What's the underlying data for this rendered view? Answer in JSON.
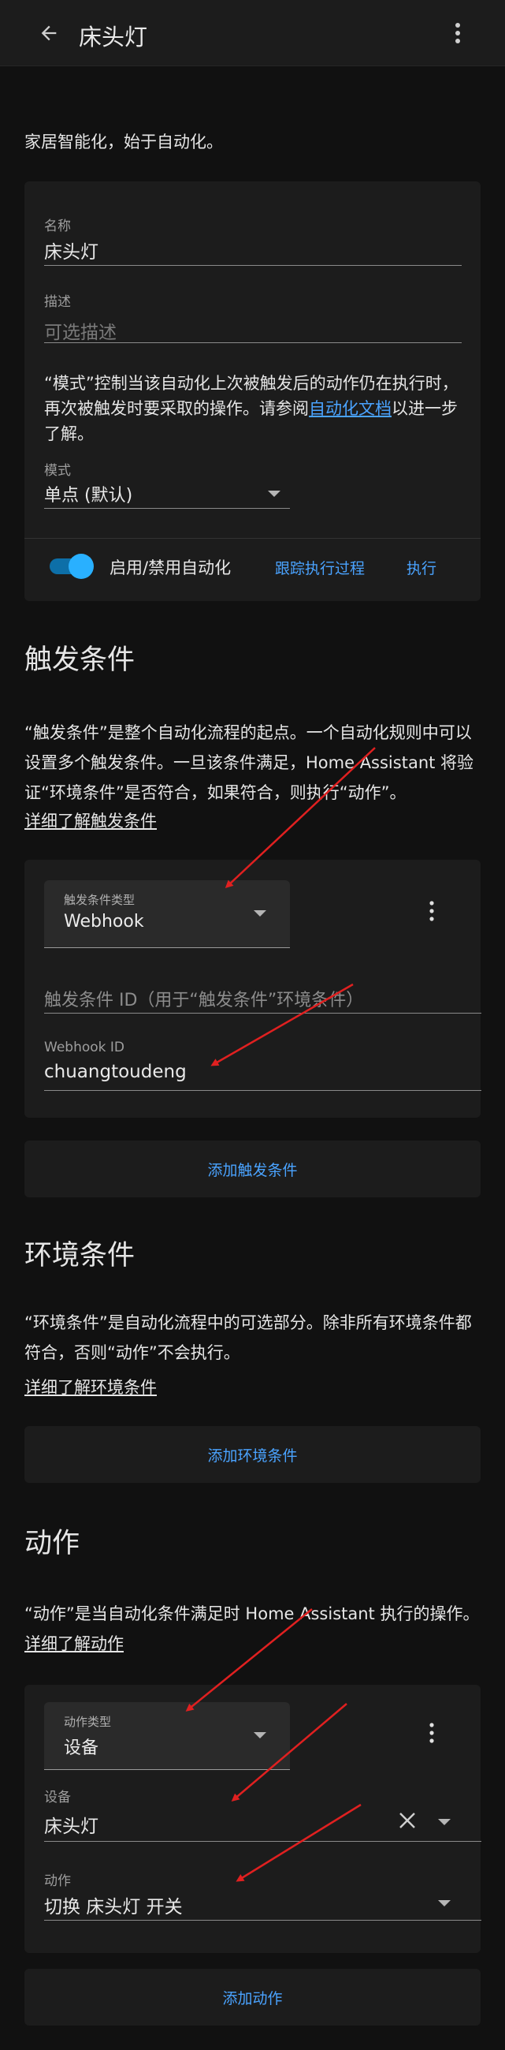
{
  "header": {
    "title": "床头灯"
  },
  "intro": "家居智能化，始于自动化。",
  "settings": {
    "name_label": "名称",
    "name_value": "床头灯",
    "desc_label": "描述",
    "desc_placeholder": "可选描述",
    "mode_text_before": "“模式”控制当该自动化上次被触发后的动作仍在执行时，再次被触发时要采取的操作。请参阅",
    "mode_link": "自动化文档",
    "mode_text_after": "以进一步了解。",
    "mode_label": "模式",
    "mode_value": "单点 (默认)",
    "toggle_label": "启用/禁用自动化",
    "trace_link": "跟踪执行过程",
    "run_link": "执行"
  },
  "triggers": {
    "heading": "触发条件",
    "description": "“触发条件”是整个自动化流程的起点。一个自动化规则中可以设置多个触发条件。一旦该条件满足，Home Assistant 将验证“环境条件”是否符合，如果符合，则执行“动作”。",
    "learn_more": "详细了解触发条件",
    "type_label": "触发条件类型",
    "type_value": "Webhook",
    "id_placeholder": "触发条件 ID（用于“触发条件”环境条件）",
    "webhook_label": "Webhook ID",
    "webhook_value": "chuangtoudeng",
    "add_button": "添加触发条件"
  },
  "conditions": {
    "heading": "环境条件",
    "description": "“环境条件”是自动化流程中的可选部分。除非所有环境条件都符合，否则“动作”不会执行。",
    "learn_more": "详细了解环境条件",
    "add_button": "添加环境条件"
  },
  "actions": {
    "heading": "动作",
    "description": "“动作”是当自动化条件满足时 Home Assistant 执行的操作。",
    "learn_more": "详细了解动作",
    "type_label": "动作类型",
    "type_value": "设备",
    "device_label": "设备",
    "device_value": "床头灯",
    "action_label": "动作",
    "action_value": "切换 床头灯 开关",
    "add_button": "添加动作"
  },
  "colors": {
    "background": "#111111",
    "card": "#1c1c1c",
    "accent": "#4aa3ff",
    "annotation": "#e02020"
  }
}
